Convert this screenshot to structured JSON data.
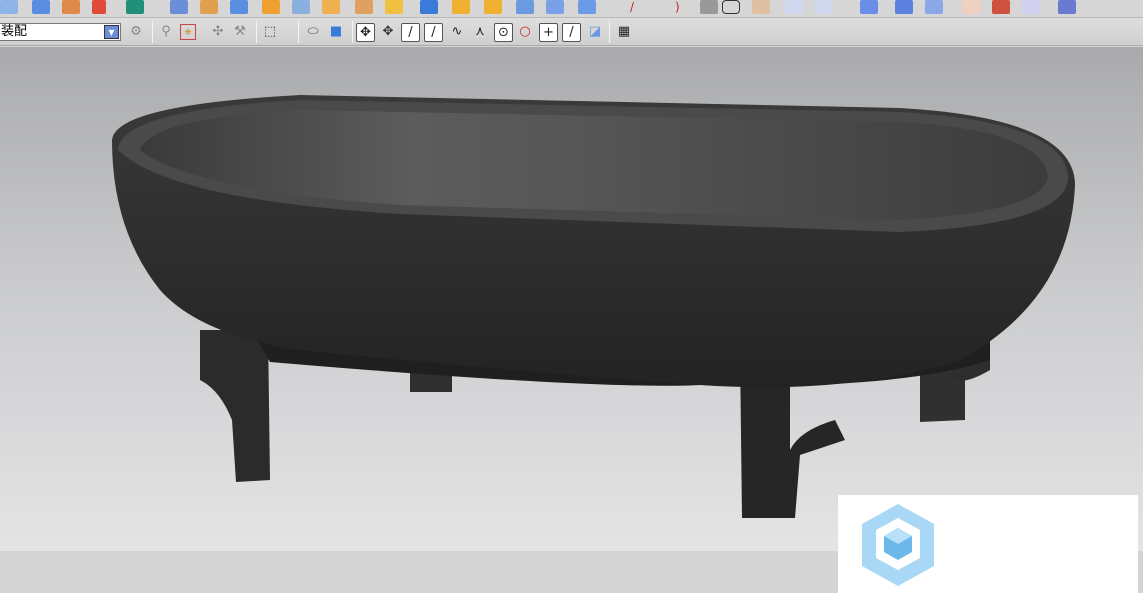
{
  "toolbar2": {
    "assembly_select": "装配"
  },
  "colors": {
    "toolbar_bg": "#d6d6d6",
    "viewport_top": "#a9aaac",
    "viewport_bottom": "#e4e4e5",
    "model": "#2a2a2a",
    "logo": "#7ec3ee"
  }
}
